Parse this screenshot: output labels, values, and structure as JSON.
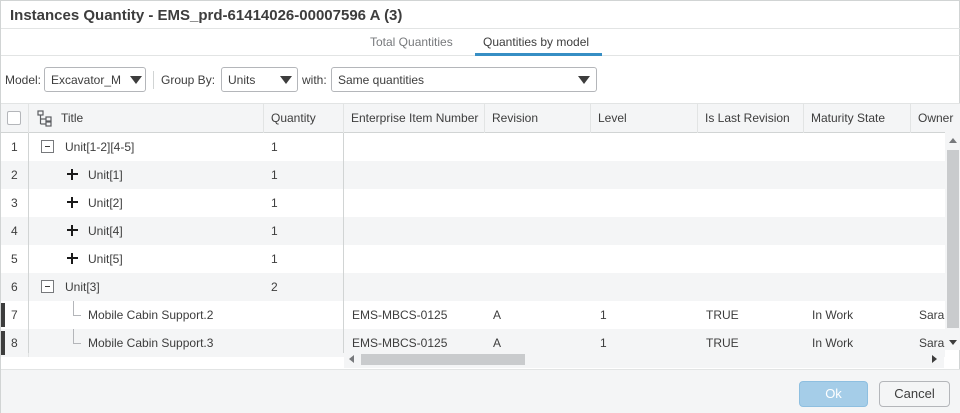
{
  "dialog": {
    "title": "Instances Quantity - EMS_prd-61414026-00007596 A (3)"
  },
  "tabs": [
    {
      "label": "Total Quantities",
      "active": false
    },
    {
      "label": "Quantities by model",
      "active": true
    }
  ],
  "toolbar": {
    "model_label": "Model:",
    "model_value": "Excavator_M",
    "group_by_label": "Group By:",
    "group_by_value": "Units",
    "with_label": "with:",
    "with_value": "Same quantities"
  },
  "grid": {
    "columns": [
      "Title",
      "Quantity",
      "Enterprise Item Number",
      "Revision",
      "Level",
      "Is Last Revision",
      "Maturity State",
      "Owner"
    ],
    "rows": [
      {
        "num": "1",
        "title": "Unit[1-2][4-5]",
        "quantity": "1",
        "eid": "",
        "revision": "",
        "level": "",
        "last": "",
        "maturity": "",
        "owner": "",
        "toggle": "minus"
      },
      {
        "num": "2",
        "title": "Unit[1]",
        "quantity": "1",
        "eid": "",
        "revision": "",
        "level": "",
        "last": "",
        "maturity": "",
        "owner": "",
        "toggle": "plus"
      },
      {
        "num": "3",
        "title": "Unit[2]",
        "quantity": "1",
        "eid": "",
        "revision": "",
        "level": "",
        "last": "",
        "maturity": "",
        "owner": "",
        "toggle": "plus"
      },
      {
        "num": "4",
        "title": "Unit[4]",
        "quantity": "1",
        "eid": "",
        "revision": "",
        "level": "",
        "last": "",
        "maturity": "",
        "owner": "",
        "toggle": "plus"
      },
      {
        "num": "5",
        "title": "Unit[5]",
        "quantity": "1",
        "eid": "",
        "revision": "",
        "level": "",
        "last": "",
        "maturity": "",
        "owner": "",
        "toggle": "plus"
      },
      {
        "num": "6",
        "title": "Unit[3]",
        "quantity": "2",
        "eid": "",
        "revision": "",
        "level": "",
        "last": "",
        "maturity": "",
        "owner": "",
        "toggle": "minus"
      },
      {
        "num": "7",
        "title": "Mobile Cabin Support.2",
        "quantity": "",
        "eid": "EMS-MBCS-0125",
        "revision": "A",
        "level": "1",
        "last": "TRUE",
        "maturity": "In Work",
        "owner": "Sara",
        "toggle": "none"
      },
      {
        "num": "8",
        "title": "Mobile Cabin Support.3",
        "quantity": "",
        "eid": "EMS-MBCS-0125",
        "revision": "A",
        "level": "1",
        "last": "TRUE",
        "maturity": "In Work",
        "owner": "Sara",
        "toggle": "none"
      }
    ]
  },
  "footer": {
    "ok_label": "Ok",
    "cancel_label": "Cancel"
  },
  "colors": {
    "accent": "#368ec4",
    "ok_button": "#a5cde8",
    "header_bg": "#f4f5f6",
    "text": "#3d3d3d"
  },
  "icons": {
    "tree_column": "hierarchy-icon",
    "expand": "plus-icon",
    "collapse": "minus-icon"
  }
}
